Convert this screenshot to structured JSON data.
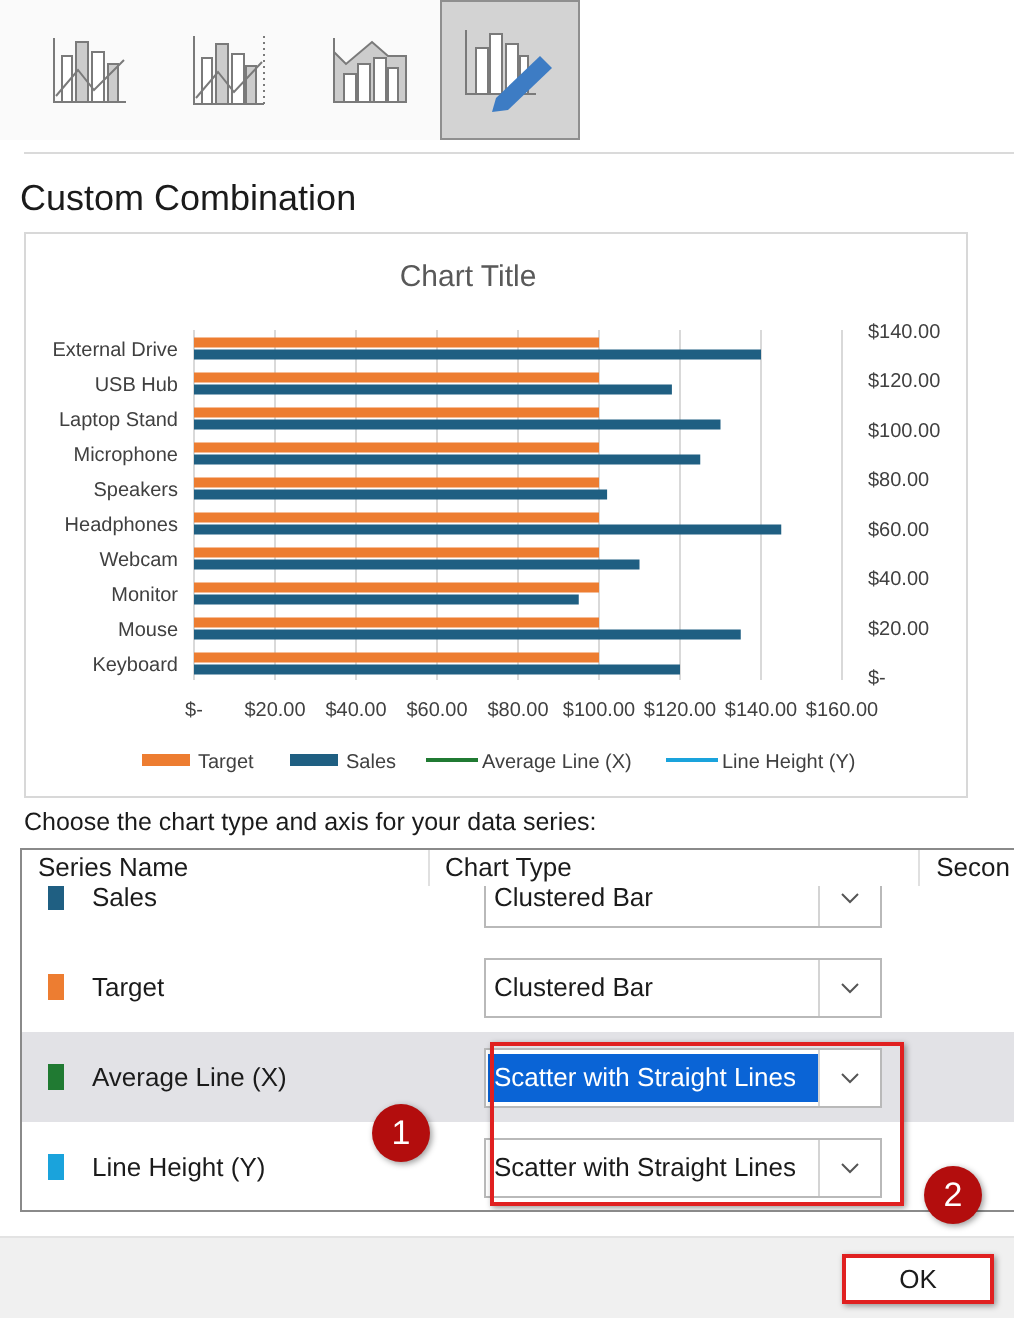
{
  "chart_types": [
    {
      "kind": "column-line",
      "selected": false
    },
    {
      "kind": "column-line-secondary",
      "selected": false
    },
    {
      "kind": "area-column",
      "selected": false
    },
    {
      "kind": "custom",
      "selected": true
    }
  ],
  "heading": "Custom Combination",
  "chart": {
    "chart_data": {
      "type": "bar",
      "orientation": "horizontal",
      "title": "Chart Title",
      "categories": [
        "External Drive",
        "USB Hub",
        "Laptop Stand",
        "Microphone",
        "Speakers",
        "Headphones",
        "Webcam",
        "Monitor",
        "Mouse",
        "Keyboard"
      ],
      "series": [
        {
          "name": "Target",
          "color": "#ed7d31",
          "values": [
            100,
            100,
            100,
            100,
            100,
            100,
            100,
            100,
            100,
            100
          ]
        },
        {
          "name": "Sales",
          "color": "#1f5f82",
          "values": [
            140,
            118,
            130,
            125,
            102,
            145,
            110,
            95,
            135,
            120
          ]
        },
        {
          "name": "Average Line (X)",
          "color": "#207a32",
          "values": [
            null,
            null,
            null,
            null,
            null,
            null,
            null,
            null,
            null,
            null
          ]
        },
        {
          "name": "Line Height (Y)",
          "color": "#1aa3dc",
          "values": [
            null,
            null,
            null,
            null,
            null,
            null,
            null,
            null,
            null,
            null
          ]
        }
      ],
      "grid": true,
      "legend": true,
      "xlim": [
        0,
        160
      ],
      "y2lim": [
        0,
        140
      ],
      "xticks": [
        {
          "value": 0,
          "label": "$-"
        },
        {
          "value": 20,
          "label": "$20.00"
        },
        {
          "value": 40,
          "label": "$40.00"
        },
        {
          "value": 60,
          "label": "$60.00"
        },
        {
          "value": 80,
          "label": "$80.00"
        },
        {
          "value": 100,
          "label": "$100.00"
        },
        {
          "value": 120,
          "label": "$120.00"
        },
        {
          "value": 140,
          "label": "$140.00"
        },
        {
          "value": 160,
          "label": "$160.00"
        }
      ],
      "y2ticks": [
        {
          "value": 0,
          "label": "$-"
        },
        {
          "value": 20,
          "label": "$20.00"
        },
        {
          "value": 40,
          "label": "$40.00"
        },
        {
          "value": 60,
          "label": "$60.00"
        },
        {
          "value": 80,
          "label": "$80.00"
        },
        {
          "value": 100,
          "label": "$100.00"
        },
        {
          "value": 120,
          "label": "$120.00"
        },
        {
          "value": 140,
          "label": "$140.00"
        }
      ]
    }
  },
  "instruction": "Choose the chart type and axis for your data series:",
  "table": {
    "columns": [
      "Series Name",
      "Chart Type",
      "Secon"
    ],
    "rows": [
      {
        "name": "Sales",
        "color": "#1f5f82",
        "chart_type": "Clustered Bar",
        "selected": false
      },
      {
        "name": "Target",
        "color": "#ed7d31",
        "chart_type": "Clustered Bar",
        "selected": false
      },
      {
        "name": "Average Line (X)",
        "color": "#207a32",
        "chart_type": "Scatter with Straight Lines",
        "selected": true,
        "highlighted": true
      },
      {
        "name": "Line Height (Y)",
        "color": "#1aa3dc",
        "chart_type": "Scatter with Straight Lines",
        "selected": false,
        "highlighted": true
      }
    ]
  },
  "callouts": [
    "1",
    "2"
  ],
  "ok_button": {
    "label": "OK",
    "highlighted": true
  }
}
